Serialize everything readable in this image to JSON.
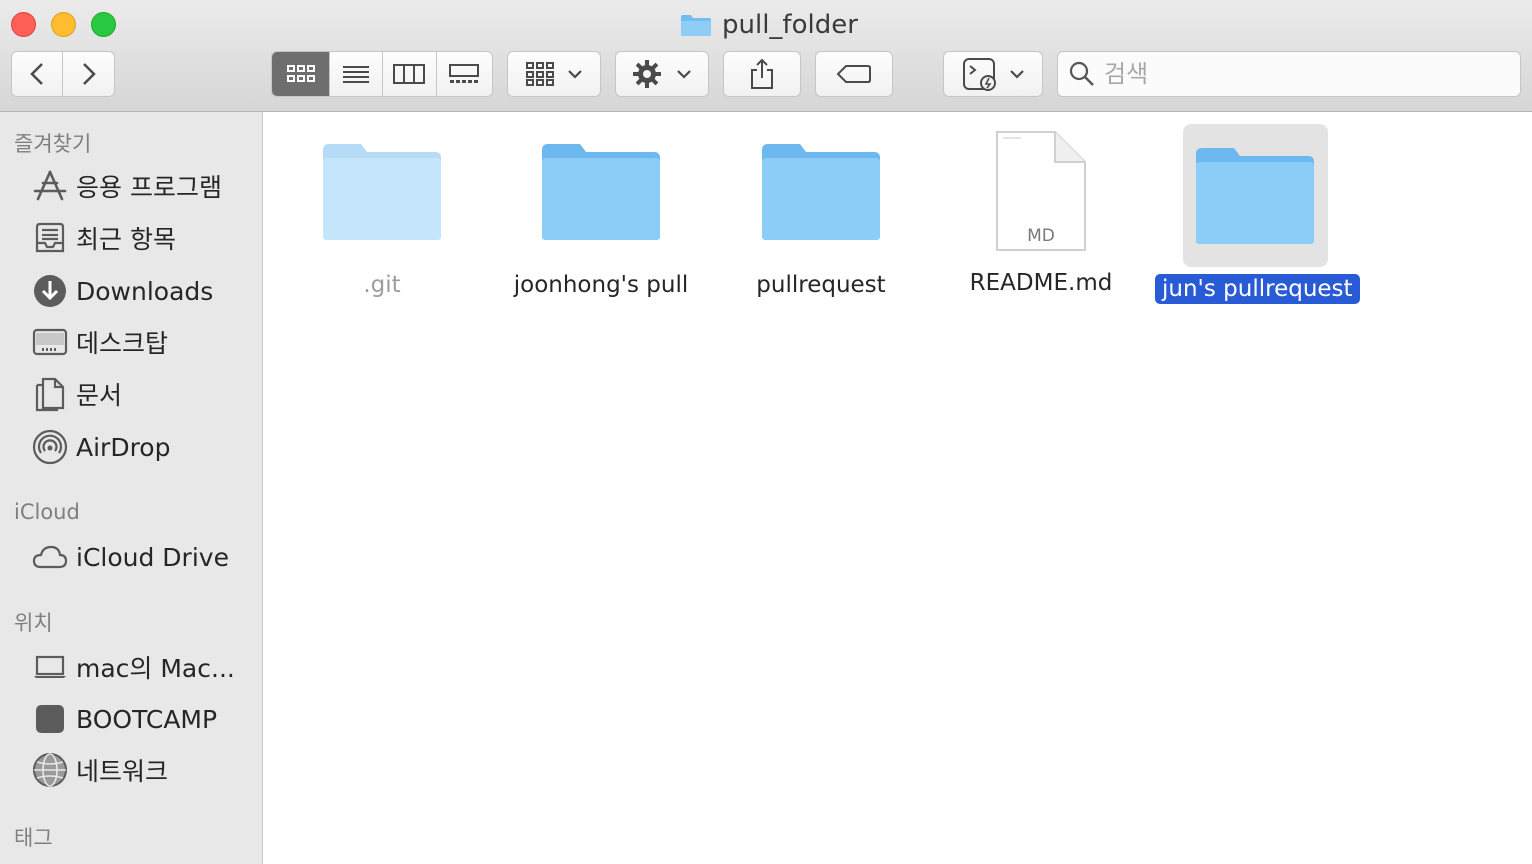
{
  "window": {
    "title": "pull_folder"
  },
  "toolbar": {
    "search_placeholder": "검색"
  },
  "sidebar": {
    "sections": {
      "favorites": "즐겨찾기",
      "icloud": "iCloud",
      "locations": "위치",
      "tags": "태그"
    },
    "favorites": [
      {
        "label": "응용 프로그램",
        "icon": "applications-icon"
      },
      {
        "label": "최근 항목",
        "icon": "recents-icon"
      },
      {
        "label": "Downloads",
        "icon": "downloads-icon"
      },
      {
        "label": "데스크탑",
        "icon": "desktop-icon"
      },
      {
        "label": "문서",
        "icon": "documents-icon"
      },
      {
        "label": "AirDrop",
        "icon": "airdrop-icon"
      }
    ],
    "icloud": [
      {
        "label": "iCloud Drive",
        "icon": "cloud-icon"
      }
    ],
    "locations": [
      {
        "label": "mac의 Mac...",
        "icon": "laptop-icon"
      },
      {
        "label": "BOOTCAMP",
        "icon": "drive-icon"
      },
      {
        "label": "네트워크",
        "icon": "network-icon"
      }
    ]
  },
  "files": [
    {
      "name": ".git",
      "kind": "folder",
      "hidden": true,
      "selected": false
    },
    {
      "name": "joonhong's pull",
      "kind": "folder",
      "hidden": false,
      "selected": false
    },
    {
      "name": "pullrequest",
      "kind": "folder",
      "hidden": false,
      "selected": false
    },
    {
      "name": "README.md",
      "kind": "document",
      "badge": "MD",
      "hidden": false,
      "selected": false
    },
    {
      "name": "jun's pullrequest",
      "kind": "folder",
      "hidden": false,
      "selected": true
    }
  ],
  "colors": {
    "selection": "#2a5bd7",
    "folder": "#7fc3f2"
  }
}
